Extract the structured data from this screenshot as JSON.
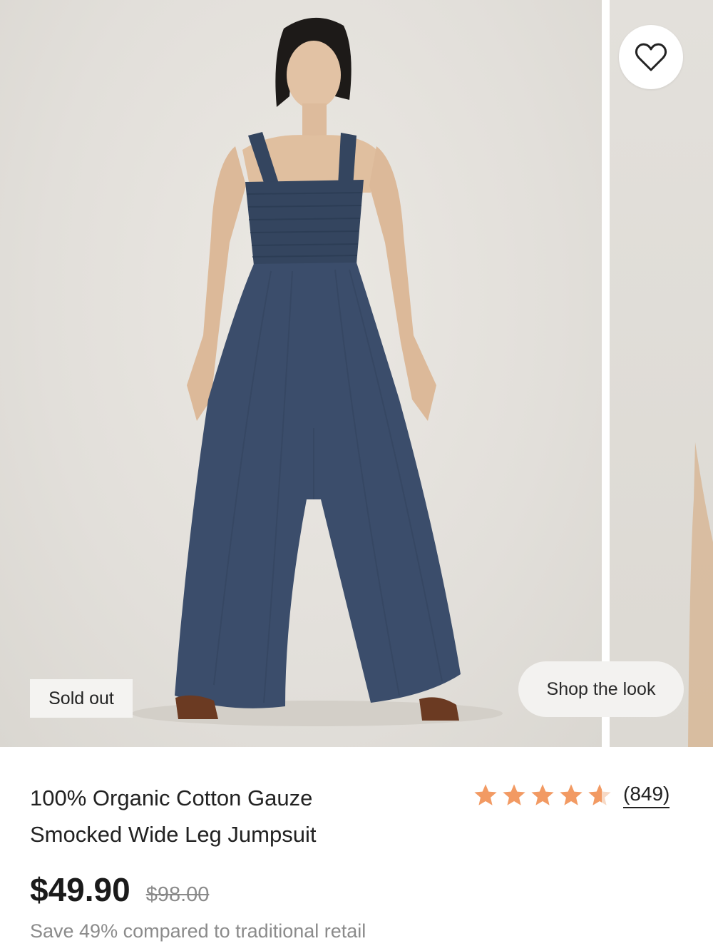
{
  "gallery": {
    "wishlist_icon": "heart-outline-icon",
    "badge": "Sold out",
    "shop_the_look": "Shop the look"
  },
  "product": {
    "title_line1": "100% Organic Cotton Gauze",
    "title_line2": "Smocked Wide Leg Jumpsuit",
    "rating": 4.6,
    "rating_max": 5,
    "review_count": "(849)",
    "price": "$49.90",
    "original_price": "$98.00",
    "savings": "Save 49% compared to traditional retail"
  },
  "colors": {
    "star": "#f29a63",
    "star_empty": "#f7d9c5",
    "jumpsuit": "#3b4d6b"
  }
}
